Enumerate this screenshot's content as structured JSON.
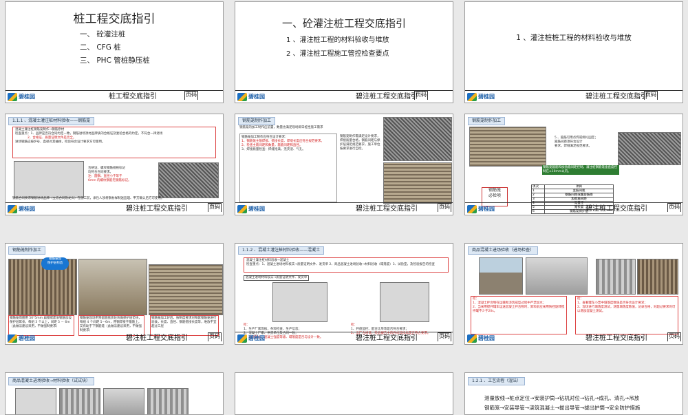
{
  "footer": {
    "brand": "碧桂园",
    "title": "桩工程交底指引",
    "title_alt": "碧注桩工程交底指引",
    "page_label": "页码"
  },
  "s1": {
    "title": "桩工程交底指引",
    "items": [
      "一、 砼灌注桩",
      "二、 CFG 桩",
      "三、 PHC 管桩静压桩"
    ]
  },
  "s2": {
    "title": "一、砼灌注桩工程交底指引",
    "items": [
      "1 、灌注桩工程的材料验收与堆放",
      "2 、灌注桩工程施工管控检查要点"
    ]
  },
  "s3": {
    "title": "1 、灌注桩桩工程的材料验收与堆放"
  },
  "s4": {
    "header": "1.1.1 、混凝土灌注桩材料验收——钢筋笼",
    "lines": [
      "混凝土灌注桩钢筋笼制作→钢筋原材",
      "检查重点：1、品牌是否符合同约定一致，钢筋进场须材品牌质的合格证及复验合格的约定，不符合一律退场",
      "2、合格证、质量证明文件是否全。",
      "进场钢筋应按炉号、直径对其抽样，检验符合设计要求方可使用。"
    ],
    "note": [
      "合格证、螺纹钢筋规格标记",
      "均符合合同要求。",
      "注：圆钢、直径小于等于",
      "6mm 的螺纹钢筋无钢筋标记。"
    ],
    "bottom": "钢筋合同要求钢筋进场品牌（立信合同及龙头）在施工前，承包人须将钢材样制送监理、甲方确认后方可使用。"
  },
  "s5": {
    "header": "钢筋笼制作加工",
    "intro": "钢筋笼的加工制作应前置，数量也满足现场即日桩性施工需求",
    "points": [
      "钢筋笼加工制作应符合设计要求：",
      "1、钢筋笼主筋焊接、搭接长度、焊缝长度应符合规范要求。",
      "2、检查主筋间距和数量，箍筋间距和直径。",
      "3、焊接质量检查：焊缝饱满，无夹渣、气孔。"
    ],
    "right": "钢筋笼制作需满足设计要求，焊接质量合格，钢筋间距与保护层满足规范要求，施工单位按要求进行自检。"
  },
  "s6": {
    "header": "钢筋笼制作加工",
    "notes": [
      "5 、箍筋可用点焊或绑扎固定；",
      "箍筋间距须符合设计",
      "要求，焊缝满足规范要求。"
    ],
    "callout": "钢筋笼箍筋和加劲箍间距控制，灌注桩钢筋笼垂直度控制在±10mm以内。",
    "label": "钢筋笼\n必检项",
    "table_head": [
      "项次",
      "项目"
    ],
    "table_rows": [
      [
        "1",
        "主筋间距"
      ],
      [
        "2",
        "钢筋间距或螺旋筋距"
      ],
      [
        "3",
        "加劲箍间距"
      ],
      [
        "4",
        "笼直径"
      ],
      [
        "5",
        "笼长度"
      ],
      [
        "6",
        "钢筋笼保护层"
      ]
    ]
  },
  "s7": {
    "header": "钢筋笼制作加工",
    "bubble": "钢筋笼加\n保护层构造",
    "captions": [
      "钢筋笼周圈用 50*5mm 扁钢或废旧钢筋加设保护层耳朵，每组 3 个以上，间距 5 － 6m（此做法建议采用，不做强制要求）",
      "钢筋笼现场用预留圆盘状砼块做保护层垫块，每组 4 个间距 5－6m，用钢焊接于箍筋上，又有助于下钢筋笼（此做法建议采用，不做强制要求）",
      "钢筋笼加工好后，按制度要求对每套钢筋笼进行验收，长度、直径、钢筋搭接长度等，堆放不宜超过三层"
    ]
  },
  "s8": {
    "header": "1.1.2 、混凝土灌注桩材料验收——混凝土",
    "box1": [
      "混凝土灌注桩材料验收→混凝土",
      "检查重点：1、混凝土进场材料核实→质量证明文件、发货单    2、商品混凝土进场验收→材料验收（塌落度）3、试验室，及检验报告的检查"
    ],
    "subhdr": "混凝土进场材料核实→质量证明文件、发货单",
    "left_notes": [
      "检：",
      "1、生产厂家等核，条料检查、生产信息；",
      "2、混凝土厂家、供货单位及合同一致；",
      "3、浇筑部位、混凝土强度等级、塌落度是否与设计一致。"
    ],
    "right_notes": [
      "检：",
      "1、开盘监控、配合比单等是否符合要求；",
      "2、出厂合格证、检验报告中的各材料指标是否符合要求。"
    ]
  },
  "s9": {
    "header": "商品混凝土进场验收（进场检查）",
    "left_notes": [
      "检：",
      "1、混凝土拌合物在运输和浇筑成型过程中严禁加水；",
      "2、当采用搅拌罐车运送混凝土拌合物时，卸料前应采用快挡旋转搅拌罐不少于20s。"
    ],
    "right_notes": [
      "检：",
      "1、查看罐车小票中塌落度数值是否符合设计要求；",
      "2、现场进行塌落度测试，测量塌落度数值，记录合格，对超过要求的可以增加混凝土测试。"
    ]
  },
  "s10": {
    "header": "商品混凝土进场验收→材料验收（试试块）"
  },
  "s12": {
    "header": "1.2.1 、工艺流程（湿法）",
    "flow": [
      "测量放线→桩点定位→安装护筒→钻机对位→钻孔→成孔、清孔→吊放",
      "钢筋笼→安装导管→浇筑混凝土→拔出导管→拔出护筒→安全防护措施"
    ]
  }
}
